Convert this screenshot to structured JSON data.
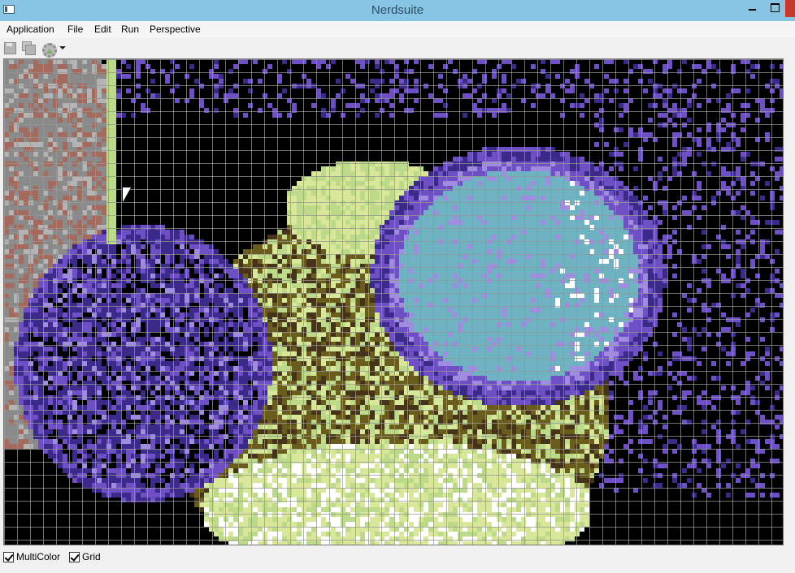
{
  "window": {
    "title": "Nerdsuite"
  },
  "menubar": {
    "items": [
      {
        "label": "Application"
      },
      {
        "label": "File"
      },
      {
        "label": "Edit"
      },
      {
        "label": "Run"
      },
      {
        "label": "Perspective"
      }
    ]
  },
  "toolbar": {
    "icons": [
      "save-icon",
      "save-all-icon",
      "run-settings-gear-icon",
      "chevron-down-icon"
    ]
  },
  "canvas": {
    "image": "C64 multicolor pixel art of a face wearing goggles",
    "palette": {
      "black": "#000000",
      "dark_blue": "#3b2a8a",
      "purple": "#6f4fc4",
      "light_purple": "#a08de0",
      "light_blue": "#6fb3c3",
      "white": "#ffffff",
      "olive": "#6a5c1c",
      "brown": "#45331a",
      "light_green": "#bdd98a",
      "yellow_green": "#d9e79a",
      "pink_brown": "#a56a5e",
      "gray": "#8a8a8a",
      "light_gray": "#b4b4b4"
    },
    "grid_enabled": true
  },
  "statusbar": {
    "multicolor": {
      "label": "MultiColor",
      "checked": true
    },
    "grid": {
      "label": "Grid",
      "checked": true
    }
  }
}
